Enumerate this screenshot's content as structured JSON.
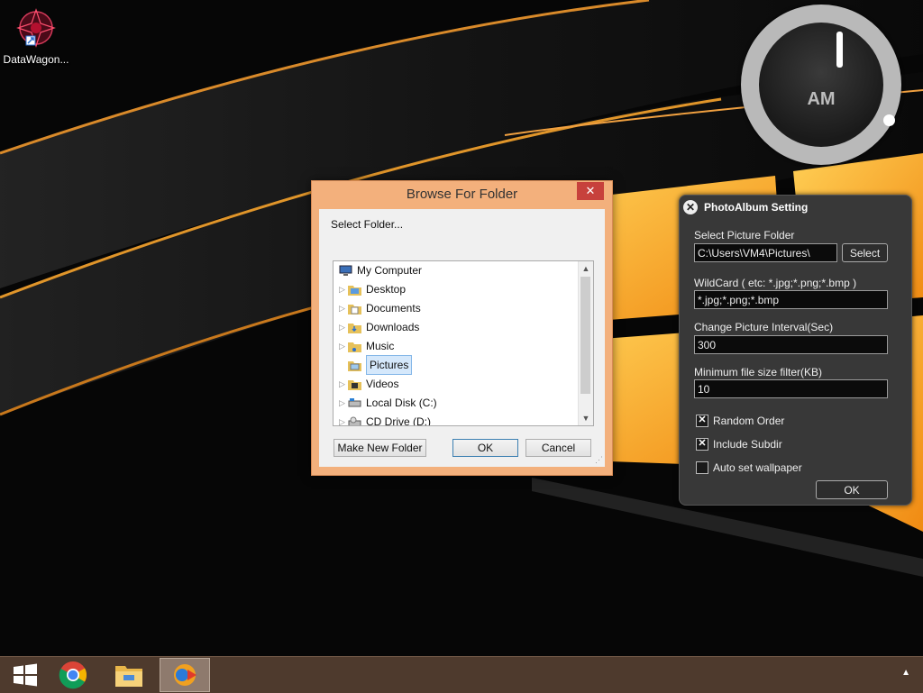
{
  "desktop": {
    "icon_label": "DataWagon..."
  },
  "clock": {
    "ampm": "AM"
  },
  "browse_dialog": {
    "title": "Browse For Folder",
    "close_glyph": "✕",
    "prompt": "Select Folder...",
    "tree": {
      "items": [
        {
          "label": "My Computer",
          "icon": "computer-icon",
          "expand": false,
          "level": 0
        },
        {
          "label": "Desktop",
          "icon": "folder-icon",
          "expand": true,
          "level": 1
        },
        {
          "label": "Documents",
          "icon": "folder-icon",
          "expand": true,
          "level": 1
        },
        {
          "label": "Downloads",
          "icon": "folder-icon",
          "expand": true,
          "level": 1
        },
        {
          "label": "Music",
          "icon": "folder-icon",
          "expand": true,
          "level": 1
        },
        {
          "label": "Pictures",
          "icon": "folder-icon",
          "expand": false,
          "level": 1,
          "selected": true
        },
        {
          "label": "Videos",
          "icon": "folder-icon",
          "expand": true,
          "level": 1
        },
        {
          "label": "Local Disk (C:)",
          "icon": "drive-icon",
          "expand": true,
          "level": 1
        },
        {
          "label": "CD Drive (D:)",
          "icon": "cd-drive-icon",
          "expand": true,
          "level": 1
        }
      ]
    },
    "buttons": {
      "make_new_folder": "Make New Folder",
      "ok": "OK",
      "cancel": "Cancel"
    }
  },
  "photoalbum": {
    "title": "PhotoAlbum Setting",
    "close_glyph": "✕",
    "folder_label": "Select Picture Folder",
    "folder_value": "C:\\Users\\VM4\\Pictures\\",
    "select_button": "Select",
    "wildcard_label": "WildCard ( etc: *.jpg;*.png;*.bmp )",
    "wildcard_value": "*.jpg;*.png;*.bmp",
    "interval_label": "Change Picture Interval(Sec)",
    "interval_value": "300",
    "minsize_label": "Minimum file size filter(KB)",
    "minsize_value": "10",
    "random_order_label": "Random Order",
    "random_order_checked": true,
    "include_subdir_label": "Include Subdir",
    "include_subdir_checked": true,
    "auto_wallpaper_label": "Auto set wallpaper",
    "auto_wallpaper_checked": false,
    "ok_button": "OK",
    "check_glyph": "✕"
  },
  "taskbar": {
    "items": [
      "start-icon",
      "chrome-icon",
      "file-explorer-icon",
      "photoalbum-app-icon"
    ],
    "tray_glyph": "▲",
    "colors": {
      "background": "#4e3a2d",
      "active": "#8e7a6d"
    }
  }
}
